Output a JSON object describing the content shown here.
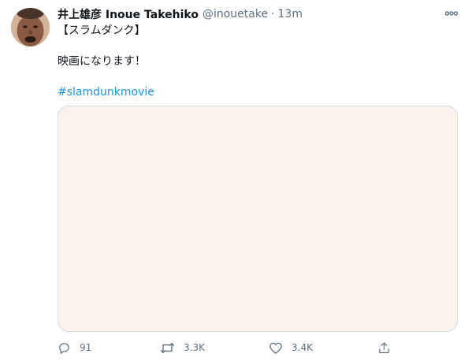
{
  "tweet": {
    "display_name": "井上雄彦 Inoue Takehiko",
    "handle": "@inouetake",
    "separator": "·",
    "time": "13m",
    "text_line1": "【スラムダンク】",
    "text_line2": "映画になります！",
    "hashtag": "#slamdunkmovie"
  },
  "actions": {
    "reply_count": "91",
    "retweet_count": "3.3K",
    "like_count": "3.4K"
  },
  "icons": {
    "more": "more-icon",
    "reply": "reply-icon",
    "retweet": "retweet-icon",
    "like": "like-icon",
    "share": "share-icon"
  },
  "colors": {
    "link": "#1b95e0",
    "secondary_text": "#5b7083",
    "media_bg": "#fbf2ee",
    "media_border": "#cfd9de"
  }
}
